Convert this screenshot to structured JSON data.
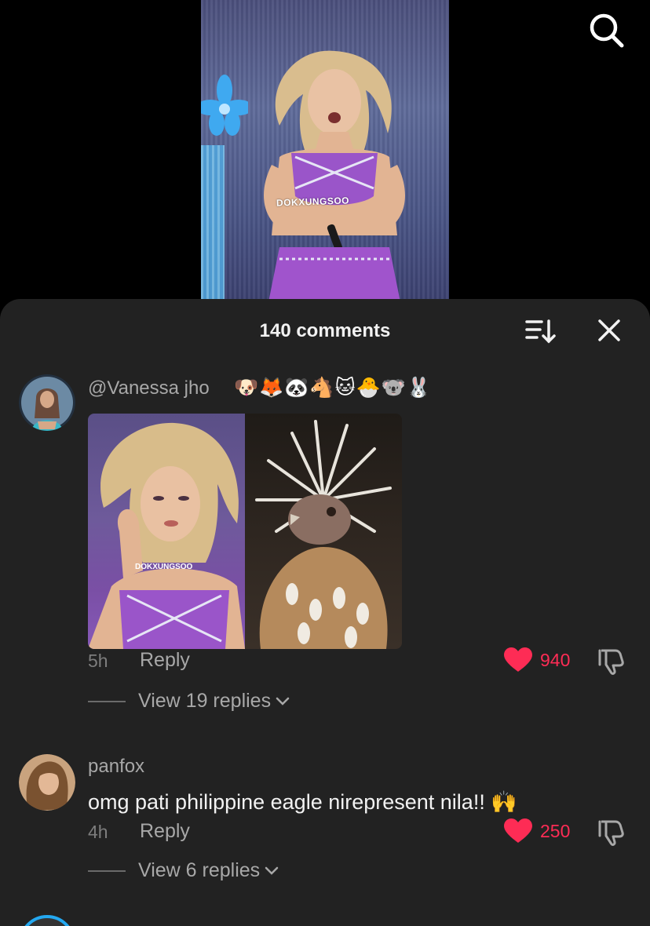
{
  "video": {
    "watermark": "DOKXUNGSOO",
    "search_icon": "search-icon"
  },
  "sheet": {
    "title": "140 comments",
    "sort_icon": "sort-icon",
    "close_icon": "close-icon"
  },
  "comments": [
    {
      "username": "@Vanessa jho",
      "emojis": [
        "🐶",
        "🦊",
        "🐼",
        "🐴",
        "🐱",
        "🐣",
        "🐨",
        "🐰"
      ],
      "photo_watermark": "DOKXUNGSOO",
      "time": "5h",
      "reply_label": "Reply",
      "likes": "940",
      "view_replies": "View 19 replies"
    },
    {
      "username": "panfox",
      "text": "omg pati philippine eagle nirepresent nila!! 🙌",
      "time": "4h",
      "reply_label": "Reply",
      "likes": "250",
      "view_replies": "View 6 replies"
    }
  ],
  "colors": {
    "like": "#fe2c55",
    "sheet_bg": "#222222",
    "muted_text": "#a8a8a8"
  }
}
